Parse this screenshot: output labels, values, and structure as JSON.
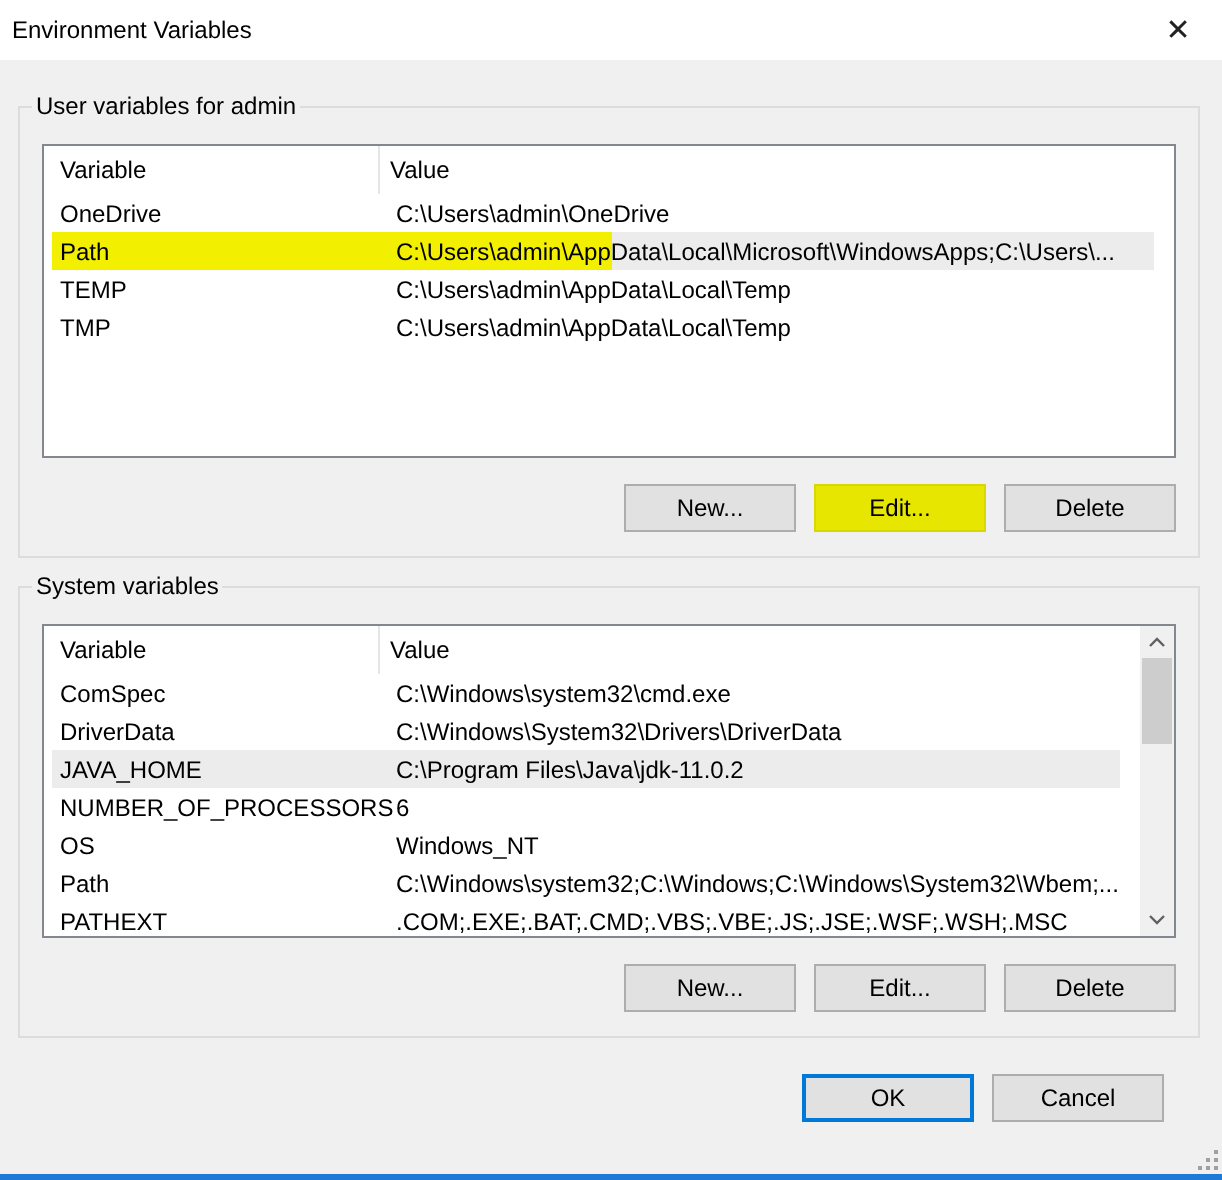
{
  "window": {
    "title": "Environment Variables",
    "close": "✕"
  },
  "groups": [
    {
      "title": "User variables for admin",
      "columns": [
        "Variable",
        "Value"
      ],
      "scrollbar": false,
      "rows": [
        {
          "name": "OneDrive",
          "value": "C:\\Users\\admin\\OneDrive",
          "selected": false,
          "highlighted": false
        },
        {
          "name": "Path",
          "value": "C:\\Users\\admin\\AppData\\Local\\Microsoft\\WindowsApps;C:\\Users\\...",
          "selected": true,
          "highlighted": true
        },
        {
          "name": "TEMP",
          "value": "C:\\Users\\admin\\AppData\\Local\\Temp",
          "selected": false,
          "highlighted": false
        },
        {
          "name": "TMP",
          "value": "C:\\Users\\admin\\AppData\\Local\\Temp",
          "selected": false,
          "highlighted": false
        }
      ],
      "buttons": [
        {
          "label": "New...",
          "highlighted": false
        },
        {
          "label": "Edit...",
          "highlighted": true
        },
        {
          "label": "Delete",
          "highlighted": false
        }
      ]
    },
    {
      "title": "System variables",
      "columns": [
        "Variable",
        "Value"
      ],
      "scrollbar": true,
      "rows": [
        {
          "name": "ComSpec",
          "value": "C:\\Windows\\system32\\cmd.exe",
          "selected": false,
          "highlighted": false
        },
        {
          "name": "DriverData",
          "value": "C:\\Windows\\System32\\Drivers\\DriverData",
          "selected": false,
          "highlighted": false
        },
        {
          "name": "JAVA_HOME",
          "value": "C:\\Program Files\\Java\\jdk-11.0.2",
          "selected": true,
          "highlighted": false
        },
        {
          "name": "NUMBER_OF_PROCESSORS",
          "value": "6",
          "selected": false,
          "highlighted": false
        },
        {
          "name": "OS",
          "value": "Windows_NT",
          "selected": false,
          "highlighted": false
        },
        {
          "name": "Path",
          "value": "C:\\Windows\\system32;C:\\Windows;C:\\Windows\\System32\\Wbem;...",
          "selected": false,
          "highlighted": false
        },
        {
          "name": "PATHEXT",
          "value": ".COM;.EXE;.BAT;.CMD;.VBS;.VBE;.JS;.JSE;.WSF;.WSH;.MSC",
          "selected": false,
          "highlighted": false
        }
      ],
      "buttons": [
        {
          "label": "New...",
          "highlighted": false
        },
        {
          "label": "Edit...",
          "highlighted": false
        },
        {
          "label": "Delete",
          "highlighted": false
        }
      ]
    }
  ],
  "footer_buttons": [
    {
      "label": "OK",
      "selected": true
    },
    {
      "label": "Cancel",
      "selected": false
    }
  ]
}
